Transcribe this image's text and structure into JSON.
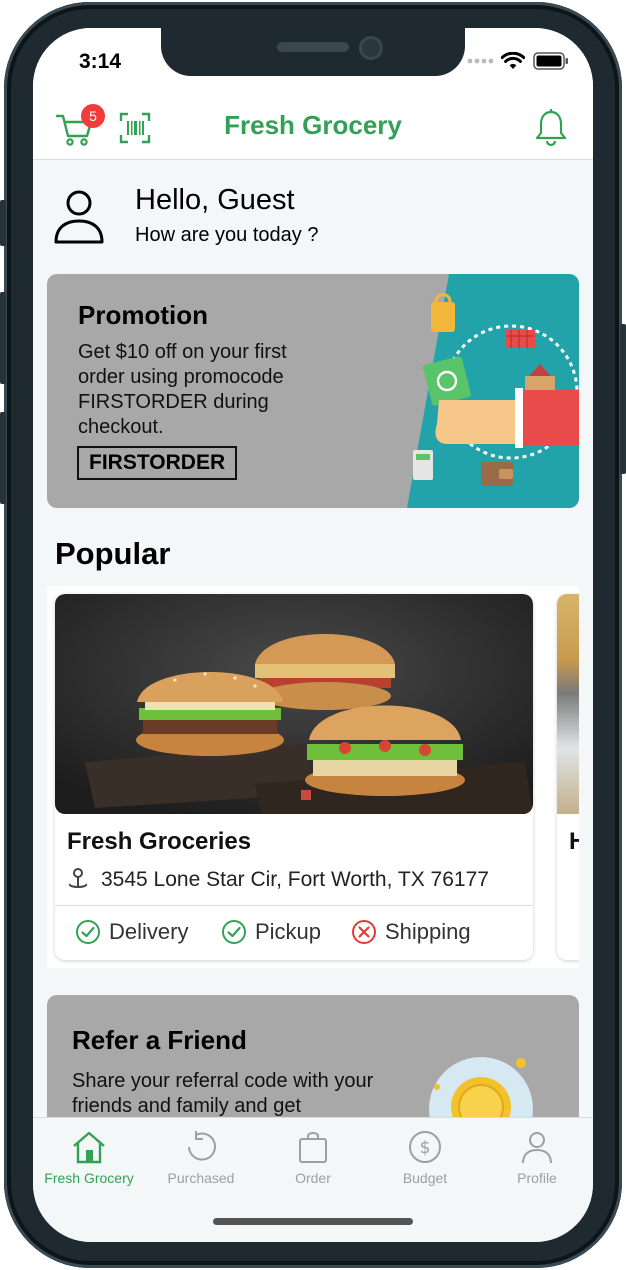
{
  "status_bar": {
    "time": "3:14"
  },
  "header": {
    "title": "Fresh Grocery",
    "cart_count": "5"
  },
  "greeting": {
    "hello": "Hello, Guest",
    "sub": "How are you today ?"
  },
  "promo": {
    "title": "Promotion",
    "text": "Get $10 off on your first order using promocode FIRSTORDER during checkout.",
    "code": "FIRSTORDER"
  },
  "popular": {
    "title": "Popular",
    "cards": [
      {
        "name": "Fresh Groceries",
        "address": "3545 Lone Star Cir, Fort Worth, TX 76177",
        "services": [
          {
            "label": "Delivery",
            "available": true
          },
          {
            "label": "Pickup",
            "available": true
          },
          {
            "label": "Shipping",
            "available": false
          }
        ]
      },
      {
        "name_initial": "H"
      }
    ]
  },
  "refer": {
    "title": "Refer a Friend",
    "text": "Share your referral code with your friends and family and get"
  },
  "tabs": [
    {
      "label": "Fresh Grocery",
      "icon": "home-icon",
      "active": true
    },
    {
      "label": "Purchased",
      "icon": "history-icon",
      "active": false
    },
    {
      "label": "Order",
      "icon": "bag-icon",
      "active": false
    },
    {
      "label": "Budget",
      "icon": "dollar-icon",
      "active": false
    },
    {
      "label": "Profile",
      "icon": "person-icon",
      "active": false
    }
  ],
  "colors": {
    "brand_green": "#33a155",
    "badge_red": "#f23b3b",
    "error_red": "#e53935",
    "promo_gray": "#a8a8a8"
  }
}
